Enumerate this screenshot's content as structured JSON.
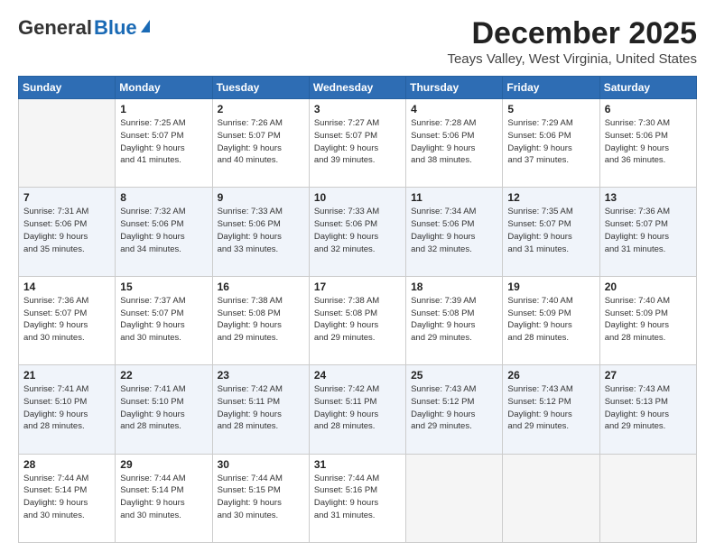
{
  "logo": {
    "general": "General",
    "blue": "Blue"
  },
  "header": {
    "month": "December 2025",
    "location": "Teays Valley, West Virginia, United States"
  },
  "days_of_week": [
    "Sunday",
    "Monday",
    "Tuesday",
    "Wednesday",
    "Thursday",
    "Friday",
    "Saturday"
  ],
  "weeks": [
    [
      {
        "day": "",
        "info": ""
      },
      {
        "day": "1",
        "info": "Sunrise: 7:25 AM\nSunset: 5:07 PM\nDaylight: 9 hours\nand 41 minutes."
      },
      {
        "day": "2",
        "info": "Sunrise: 7:26 AM\nSunset: 5:07 PM\nDaylight: 9 hours\nand 40 minutes."
      },
      {
        "day": "3",
        "info": "Sunrise: 7:27 AM\nSunset: 5:07 PM\nDaylight: 9 hours\nand 39 minutes."
      },
      {
        "day": "4",
        "info": "Sunrise: 7:28 AM\nSunset: 5:06 PM\nDaylight: 9 hours\nand 38 minutes."
      },
      {
        "day": "5",
        "info": "Sunrise: 7:29 AM\nSunset: 5:06 PM\nDaylight: 9 hours\nand 37 minutes."
      },
      {
        "day": "6",
        "info": "Sunrise: 7:30 AM\nSunset: 5:06 PM\nDaylight: 9 hours\nand 36 minutes."
      }
    ],
    [
      {
        "day": "7",
        "info": "Sunrise: 7:31 AM\nSunset: 5:06 PM\nDaylight: 9 hours\nand 35 minutes."
      },
      {
        "day": "8",
        "info": "Sunrise: 7:32 AM\nSunset: 5:06 PM\nDaylight: 9 hours\nand 34 minutes."
      },
      {
        "day": "9",
        "info": "Sunrise: 7:33 AM\nSunset: 5:06 PM\nDaylight: 9 hours\nand 33 minutes."
      },
      {
        "day": "10",
        "info": "Sunrise: 7:33 AM\nSunset: 5:06 PM\nDaylight: 9 hours\nand 32 minutes."
      },
      {
        "day": "11",
        "info": "Sunrise: 7:34 AM\nSunset: 5:06 PM\nDaylight: 9 hours\nand 32 minutes."
      },
      {
        "day": "12",
        "info": "Sunrise: 7:35 AM\nSunset: 5:07 PM\nDaylight: 9 hours\nand 31 minutes."
      },
      {
        "day": "13",
        "info": "Sunrise: 7:36 AM\nSunset: 5:07 PM\nDaylight: 9 hours\nand 31 minutes."
      }
    ],
    [
      {
        "day": "14",
        "info": "Sunrise: 7:36 AM\nSunset: 5:07 PM\nDaylight: 9 hours\nand 30 minutes."
      },
      {
        "day": "15",
        "info": "Sunrise: 7:37 AM\nSunset: 5:07 PM\nDaylight: 9 hours\nand 30 minutes."
      },
      {
        "day": "16",
        "info": "Sunrise: 7:38 AM\nSunset: 5:08 PM\nDaylight: 9 hours\nand 29 minutes."
      },
      {
        "day": "17",
        "info": "Sunrise: 7:38 AM\nSunset: 5:08 PM\nDaylight: 9 hours\nand 29 minutes."
      },
      {
        "day": "18",
        "info": "Sunrise: 7:39 AM\nSunset: 5:08 PM\nDaylight: 9 hours\nand 29 minutes."
      },
      {
        "day": "19",
        "info": "Sunrise: 7:40 AM\nSunset: 5:09 PM\nDaylight: 9 hours\nand 28 minutes."
      },
      {
        "day": "20",
        "info": "Sunrise: 7:40 AM\nSunset: 5:09 PM\nDaylight: 9 hours\nand 28 minutes."
      }
    ],
    [
      {
        "day": "21",
        "info": "Sunrise: 7:41 AM\nSunset: 5:10 PM\nDaylight: 9 hours\nand 28 minutes."
      },
      {
        "day": "22",
        "info": "Sunrise: 7:41 AM\nSunset: 5:10 PM\nDaylight: 9 hours\nand 28 minutes."
      },
      {
        "day": "23",
        "info": "Sunrise: 7:42 AM\nSunset: 5:11 PM\nDaylight: 9 hours\nand 28 minutes."
      },
      {
        "day": "24",
        "info": "Sunrise: 7:42 AM\nSunset: 5:11 PM\nDaylight: 9 hours\nand 28 minutes."
      },
      {
        "day": "25",
        "info": "Sunrise: 7:43 AM\nSunset: 5:12 PM\nDaylight: 9 hours\nand 29 minutes."
      },
      {
        "day": "26",
        "info": "Sunrise: 7:43 AM\nSunset: 5:12 PM\nDaylight: 9 hours\nand 29 minutes."
      },
      {
        "day": "27",
        "info": "Sunrise: 7:43 AM\nSunset: 5:13 PM\nDaylight: 9 hours\nand 29 minutes."
      }
    ],
    [
      {
        "day": "28",
        "info": "Sunrise: 7:44 AM\nSunset: 5:14 PM\nDaylight: 9 hours\nand 30 minutes."
      },
      {
        "day": "29",
        "info": "Sunrise: 7:44 AM\nSunset: 5:14 PM\nDaylight: 9 hours\nand 30 minutes."
      },
      {
        "day": "30",
        "info": "Sunrise: 7:44 AM\nSunset: 5:15 PM\nDaylight: 9 hours\nand 30 minutes."
      },
      {
        "day": "31",
        "info": "Sunrise: 7:44 AM\nSunset: 5:16 PM\nDaylight: 9 hours\nand 31 minutes."
      },
      {
        "day": "",
        "info": ""
      },
      {
        "day": "",
        "info": ""
      },
      {
        "day": "",
        "info": ""
      }
    ]
  ]
}
